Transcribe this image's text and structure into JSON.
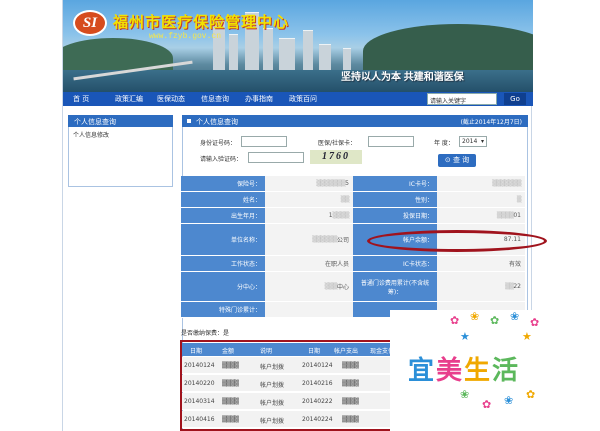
{
  "header": {
    "logo_text": "SI",
    "title": "福州市医疗保险管理中心",
    "url": "www.fzyb.gov.cn",
    "slogan": "坚持以人为本 共建和谐医保"
  },
  "nav": {
    "items": [
      "首    页",
      "政策汇编",
      "医保动态",
      "信息查询",
      "办事指南",
      "政策百问"
    ],
    "search_placeholder": "请输入关键字",
    "go_label": "Go"
  },
  "sidebar": {
    "title": "个人信息查询",
    "items": [
      "个人信息修改"
    ]
  },
  "panel": {
    "title": "个人信息查询",
    "date": "(截止2014年12月7日)"
  },
  "query": {
    "id_label": "身份证号码：",
    "card_label": "医保/社保卡：",
    "year_label": "年  度：",
    "year_value": "2014",
    "captcha_label": "请输入验证码：",
    "captcha_value": "1760",
    "submit_label": "查  询"
  },
  "info": {
    "rows": [
      {
        "l1": "保险号：",
        "v1": "5",
        "l2": "IC卡号：",
        "v2": ""
      },
      {
        "l1": "姓名：",
        "v1": "",
        "l2": "性别：",
        "v2": ""
      },
      {
        "l1": "出生年月：",
        "v1": "1",
        "l2": "投保日期：",
        "v2": "01"
      },
      {
        "l1": "单位名称：",
        "v1": "公司",
        "l2": "帐户余额：",
        "v2": "87.11"
      },
      {
        "l1": "工作状态：",
        "v1": "在职人员",
        "l2": "IC卡状态：",
        "v2": "有效"
      },
      {
        "l1": "分中心：",
        "v1": "中心",
        "l2": "普通门诊费用累计(不含统筹)：",
        "v2": "22"
      },
      {
        "l1": "特殊门诊累计：",
        "v1": "",
        "l2": "",
        "v2": ""
      }
    ],
    "status_line": "是否缴纳保费：是"
  },
  "ledger": {
    "headers_left": [
      "日期",
      "金额",
      "说明"
    ],
    "headers_right": [
      "日期",
      "帐户支出",
      "现金支付"
    ],
    "rows": [
      {
        "d1": "20140124",
        "desc": "帐户划拨",
        "d2": "20140124"
      },
      {
        "d1": "20140220",
        "desc": "帐户划拨",
        "d2": "20140216"
      },
      {
        "d1": "20140314",
        "desc": "帐户划拨",
        "d2": "20140222"
      },
      {
        "d1": "20140416",
        "desc": "帐户划拨",
        "d2": "20140224"
      }
    ]
  },
  "watermark": {
    "text": "宜美生活",
    "colors": [
      "#2b8fd8",
      "#e83e8c",
      "#f0a800",
      "#5cb85c"
    ]
  },
  "colors": {
    "nav_blue": "#1a56b8",
    "header_blue": "#2d6cc0",
    "label_blue": "#4d88cf",
    "highlight_red": "#a0131d"
  }
}
